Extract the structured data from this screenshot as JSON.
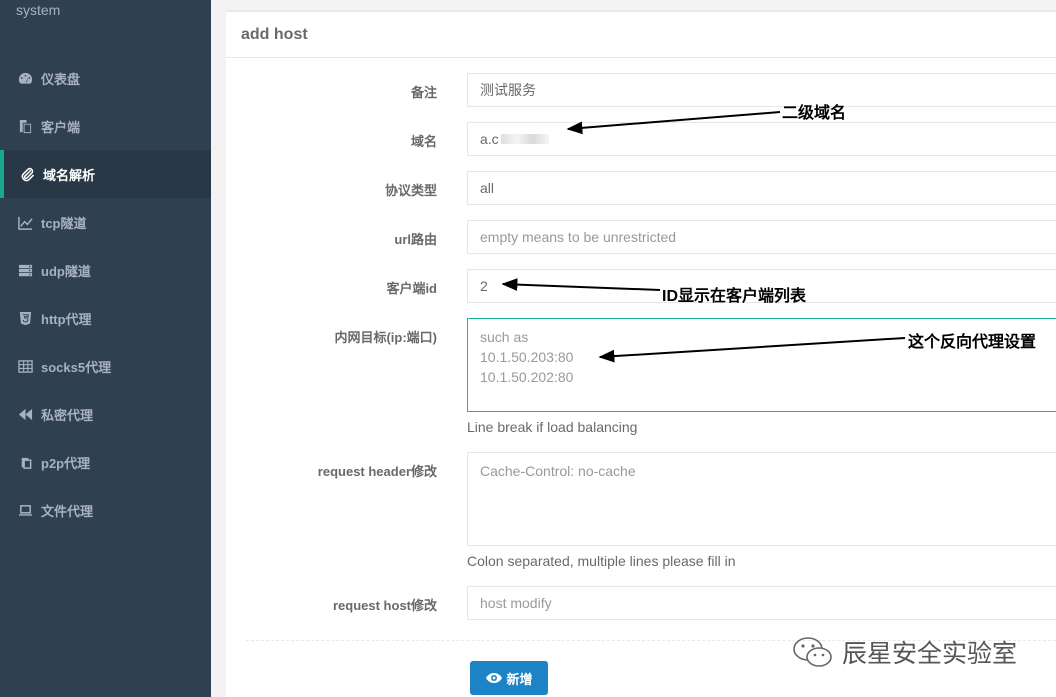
{
  "sidebar": {
    "system_label": "system",
    "items": [
      {
        "label": "仪表盘",
        "icon": "dashboard-icon"
      },
      {
        "label": "客户端",
        "icon": "copy-icon"
      },
      {
        "label": "域名解析",
        "icon": "paperclip-icon",
        "active": true
      },
      {
        "label": "tcp隧道",
        "icon": "line-chart-icon"
      },
      {
        "label": "udp隧道",
        "icon": "server-icon"
      },
      {
        "label": "http代理",
        "icon": "html5-icon"
      },
      {
        "label": "socks5代理",
        "icon": "table-icon"
      },
      {
        "label": "私密代理",
        "icon": "backward-icon"
      },
      {
        "label": "p2p代理",
        "icon": "clone-icon"
      },
      {
        "label": "文件代理",
        "icon": "laptop-icon"
      }
    ]
  },
  "panel": {
    "title": "add host"
  },
  "form": {
    "remark": {
      "label": "备注",
      "value": "测试服务"
    },
    "domain": {
      "label": "域名",
      "value": "a.c"
    },
    "protocol": {
      "label": "协议类型",
      "value": "all"
    },
    "url_route": {
      "label": "url路由",
      "placeholder": "empty means to be unrestricted"
    },
    "client_id": {
      "label": "客户端id",
      "value": "2"
    },
    "target": {
      "label": "内网目标(ip:端口)",
      "lines": [
        "such as",
        "10.1.50.203:80",
        "10.1.50.202:80"
      ],
      "help": "Line break if load balancing"
    },
    "request_header": {
      "label": "request header修改",
      "placeholder": "Cache-Control: no-cache",
      "help": "Colon separated, multiple lines please fill in"
    },
    "request_host": {
      "label": "request host修改",
      "placeholder": "host modify"
    },
    "submit_label": "新增"
  },
  "annotations": {
    "domain_note": "二级域名",
    "client_note": "ID显示在客户端列表",
    "target_note": "这个反向代理设置"
  },
  "watermark": {
    "text": "辰星安全实验室"
  },
  "colors": {
    "sidebar": "#2f4050",
    "accent": "#1ab394",
    "button": "#1c84c6"
  }
}
